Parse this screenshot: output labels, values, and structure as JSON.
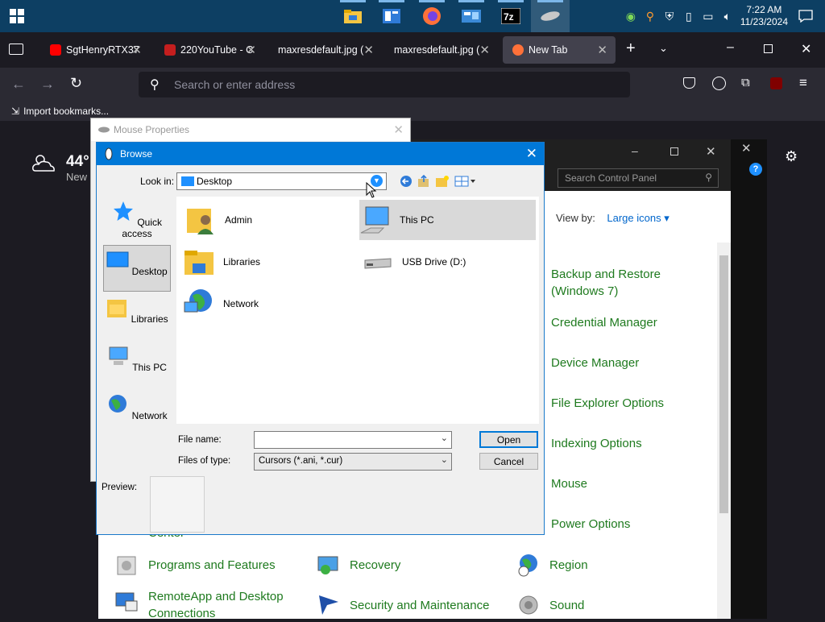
{
  "taskbar": {
    "clock_time": "7:22 AM",
    "clock_date": "11/23/2024"
  },
  "firefox": {
    "tabs": [
      {
        "label": "SgtHenryRTX37",
        "icon": "youtube-icon"
      },
      {
        "label": "220YouTube - C",
        "icon": "pdf-icon"
      },
      {
        "label": "maxresdefault.jpg (",
        "icon": "image-icon"
      },
      {
        "label": "maxresdefault.jpg (",
        "icon": "image-icon"
      },
      {
        "label": "New Tab",
        "icon": "firefox-icon"
      }
    ],
    "url_placeholder": "Search or enter address",
    "bookmark_import": "Import bookmarks...",
    "weather_temp": "44°",
    "weather_label": "New"
  },
  "control_panel": {
    "search_placeholder": "Search Control Panel",
    "view_by_label": "View by:",
    "view_by_value": "Large icons",
    "items": [
      {
        "label": "Backup and Restore (Windows 7)",
        "icon": "backup-icon"
      },
      {
        "label": "Credential Manager",
        "icon": "credential-icon"
      },
      {
        "label": "Device Manager",
        "icon": "device-manager-icon"
      },
      {
        "label": "File Explorer Options",
        "icon": "folder-options-icon"
      },
      {
        "label": "Indexing Options",
        "icon": "indexing-icon"
      },
      {
        "label": "Mouse",
        "icon": "mouse-icon"
      },
      {
        "label": "Power Options",
        "icon": "power-icon"
      },
      {
        "label": "Programs and Features",
        "icon": "programs-icon"
      },
      {
        "label": "Recovery",
        "icon": "recovery-icon"
      },
      {
        "label": "Region",
        "icon": "region-icon"
      },
      {
        "label": "RemoteApp and Desktop Connections",
        "icon": "remoteapp-icon"
      },
      {
        "label": "Security and Maintenance",
        "icon": "security-flag-icon"
      },
      {
        "label": "Sound",
        "icon": "sound-icon"
      },
      {
        "label": "Center",
        "icon": ""
      }
    ]
  },
  "mouse_properties": {
    "title": "Mouse Properties"
  },
  "browse": {
    "title": "Browse",
    "look_in_label": "Look in:",
    "look_in_value": "Desktop",
    "places": [
      {
        "label": "Quick access",
        "icon": "star-icon"
      },
      {
        "label": "Desktop",
        "icon": "desktop-icon"
      },
      {
        "label": "Libraries",
        "icon": "libraries-icon"
      },
      {
        "label": "This PC",
        "icon": "computer-icon"
      },
      {
        "label": "Network",
        "icon": "network-icon"
      }
    ],
    "files": [
      {
        "label": "Admin",
        "icon": "user-folder-icon"
      },
      {
        "label": "This PC",
        "icon": "computer-icon"
      },
      {
        "label": "Libraries",
        "icon": "libraries-icon"
      },
      {
        "label": "USB Drive (D:)",
        "icon": "usb-drive-icon"
      },
      {
        "label": "Network",
        "icon": "network-icon"
      }
    ],
    "file_name_label": "File name:",
    "file_name_value": "",
    "files_of_type_label": "Files of type:",
    "files_of_type_value": "Cursors (*.ani, *.cur)",
    "open_label": "Open",
    "cancel_label": "Cancel",
    "preview_label": "Preview:"
  }
}
